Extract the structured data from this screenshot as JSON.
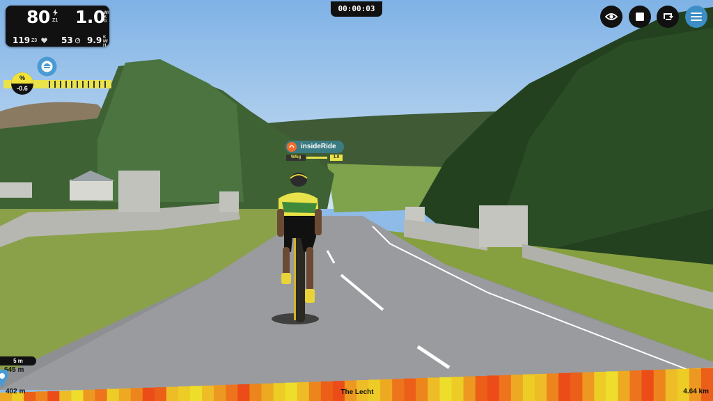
{
  "stats": {
    "power": "80",
    "power_zone": "Z1",
    "wkg": "1.0",
    "wkg_unit": "W/KG",
    "heart_rate": "119",
    "hr_zone": "Z3",
    "cadence": "53",
    "speed": "9.9",
    "speed_unit": "KM/H"
  },
  "timer": "00:00:03",
  "gradient": {
    "symbol": "%",
    "value": "-0.6"
  },
  "rider_label": {
    "name": "insideRide",
    "unit": "W/kg",
    "value": "1.0"
  },
  "course": {
    "elevation_range": "5 m",
    "current_elevation": "645 m",
    "distance_done": "402 m",
    "route_name": "The Lecht",
    "total_distance": "4.64 km"
  },
  "icons": [
    "eye-icon",
    "stop-icon",
    "loop-icon",
    "menu-icon",
    "heart-icon",
    "cadence-icon",
    "rider-icon",
    "brand-logo-icon",
    "location-pin-icon"
  ],
  "colors": {
    "accent": "#3d8ec6",
    "grade_yellow": "#f0e23a",
    "label_teal": "#3b7b82",
    "brand_orange": "#f26b2a"
  },
  "elevation_profile": [
    0.4,
    0.2,
    0.8,
    0.6,
    0.9,
    0.3,
    0.1,
    0.5,
    0.7,
    0.2,
    0.4,
    0.6,
    0.9,
    0.8,
    0.3,
    0.2,
    0.1,
    0.3,
    0.5,
    0.7,
    0.9,
    0.6,
    0.4,
    0.2,
    0.1,
    0.3,
    0.6,
    0.8,
    0.9,
    0.5,
    0.3,
    0.2,
    0.4,
    0.7,
    0.8,
    0.6,
    0.3,
    0.1,
    0.2,
    0.5,
    0.8,
    0.9,
    0.7,
    0.4,
    0.2,
    0.3,
    0.6,
    0.9,
    0.8,
    0.5,
    0.2,
    0.1,
    0.4,
    0.7,
    0.9,
    0.6,
    0.3,
    0.2,
    0.5,
    0.8
  ]
}
